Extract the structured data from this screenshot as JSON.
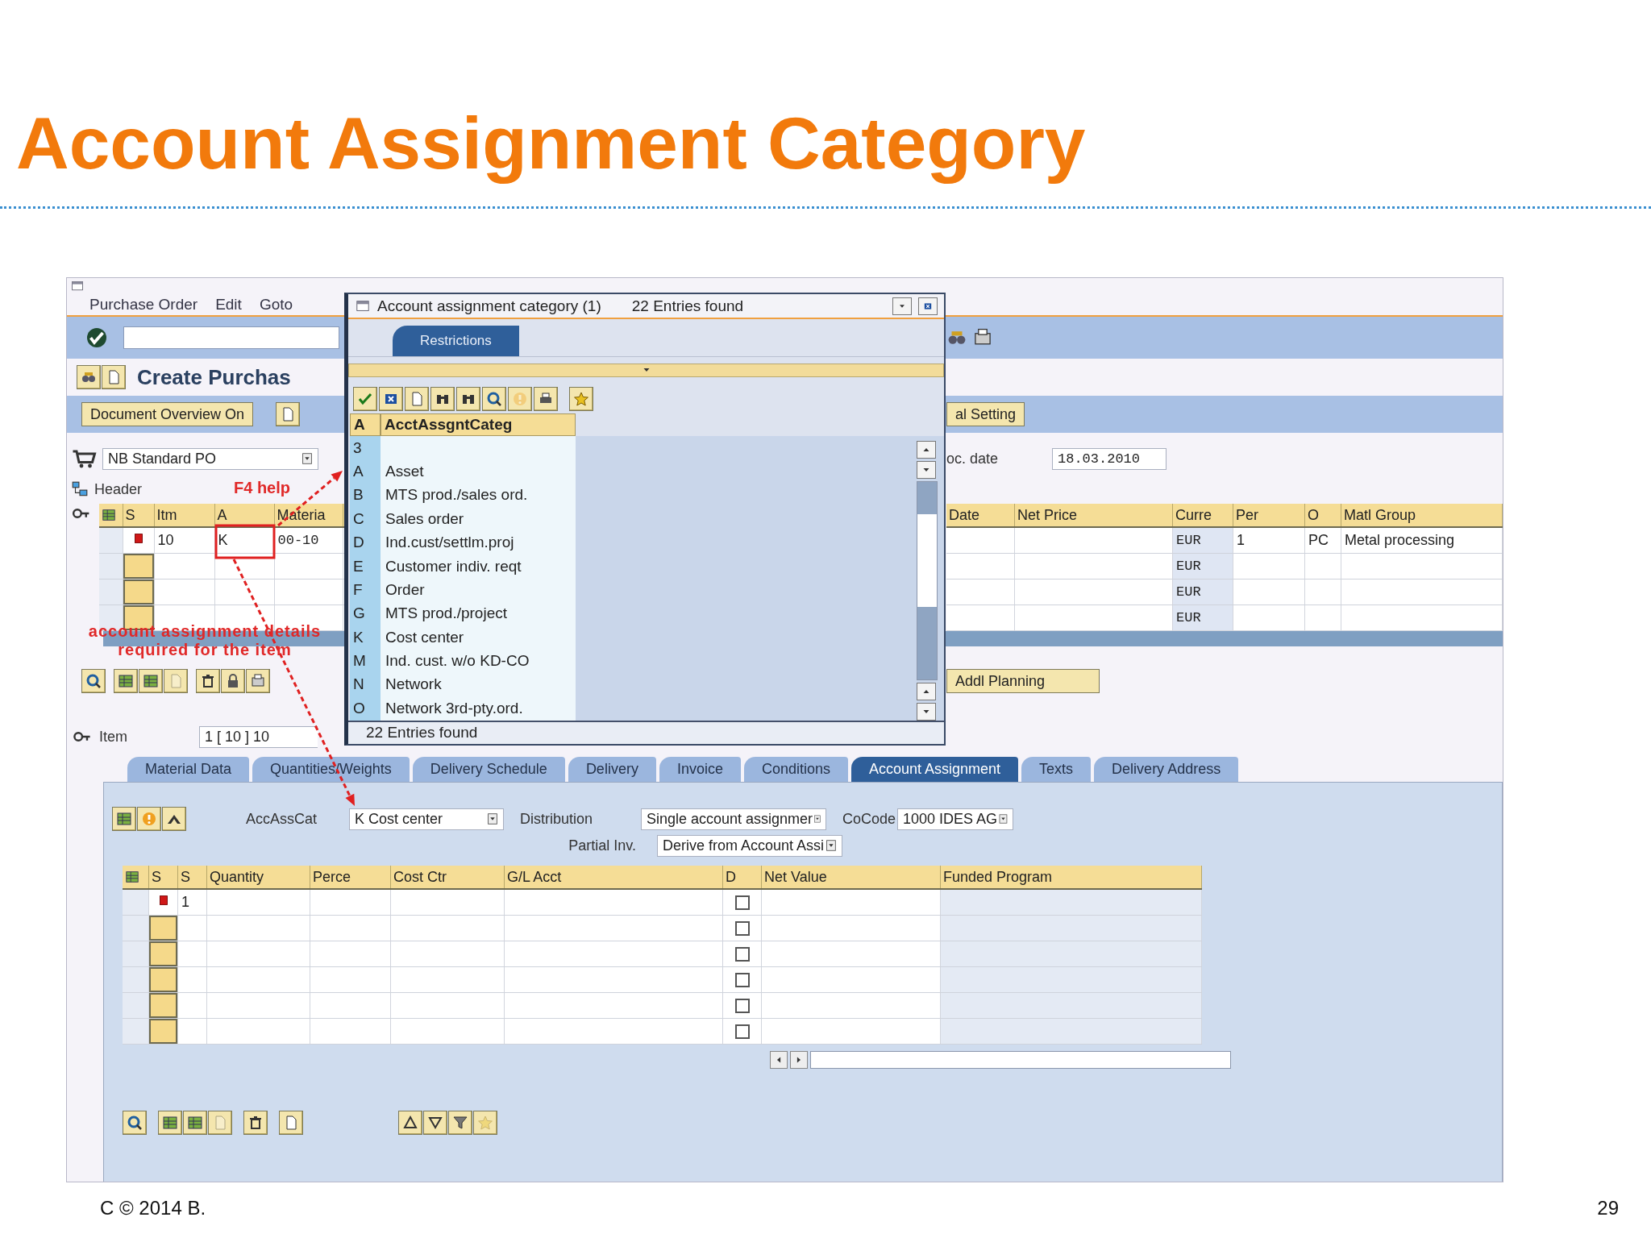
{
  "slide": {
    "title": "Account Assignment Category",
    "footer": "C © 2014 B.",
    "page_number": "29"
  },
  "window": {
    "menu": [
      "Purchase Order",
      "Edit",
      "Goto"
    ],
    "title": "Create Purchas",
    "overview_button": "Document Overview On",
    "setting_button": "al Setting",
    "po_type": "NB Standard PO",
    "doc_date_label": "oc. date",
    "doc_date": "18.03.2010",
    "header_label": "Header",
    "items_left": {
      "columns": [
        "S",
        "Itm",
        "A",
        "Materia"
      ],
      "rows": [
        {
          "flagged": true,
          "item": "10",
          "acct": "K",
          "material": "00-10"
        },
        {
          "flagged": false
        },
        {
          "flagged": false
        },
        {
          "flagged": false
        }
      ]
    },
    "items_right": {
      "columns": [
        "Date",
        "Net Price",
        "Curre",
        "Per",
        "O",
        "Matl Group"
      ],
      "rows": [
        {
          "currency": "EUR",
          "per": "1",
          "unit": "PC",
          "matl_group": "Metal processing"
        },
        {
          "currency": "EUR"
        },
        {
          "currency": "EUR"
        },
        {
          "currency": "EUR"
        }
      ]
    },
    "planning_button": "Addl Planning",
    "item_label": "Item",
    "item_field": "1 [ 10 ] 10",
    "tabs": [
      {
        "label": "Material Data",
        "selected": false
      },
      {
        "label": "Quantities/Weights",
        "selected": false
      },
      {
        "label": "Delivery Schedule",
        "selected": false
      },
      {
        "label": "Delivery",
        "selected": false
      },
      {
        "label": "Invoice",
        "selected": false
      },
      {
        "label": "Conditions",
        "selected": false
      },
      {
        "label": "Account Assignment",
        "selected": true
      },
      {
        "label": "Texts",
        "selected": false
      },
      {
        "label": "Delivery Address",
        "selected": false
      }
    ],
    "account": {
      "acc_ass_cat_label": "AccAssCat",
      "acc_ass_cat": "K Cost center",
      "distribution_label": "Distribution",
      "distribution": "Single account assignmer",
      "partial_inv_label": "Partial Inv.",
      "partial_inv": "Derive from Account Assi",
      "cocode_label": "CoCode",
      "cocode": "1000 IDES AG"
    },
    "account_table": {
      "columns": [
        "S",
        "S",
        "Quantity",
        "Perce",
        "Cost Ctr",
        "G/L Acct",
        "D",
        "Net Value",
        "Funded Program"
      ],
      "rows": [
        {
          "flagged": true,
          "number": "1",
          "checked": false
        },
        {
          "flagged": false,
          "checked": false
        },
        {
          "flagged": false,
          "checked": false
        },
        {
          "flagged": false,
          "checked": false
        },
        {
          "flagged": false,
          "checked": false
        },
        {
          "flagged": false,
          "checked": false
        }
      ]
    }
  },
  "popup": {
    "title": "Account assignment category (1)",
    "count": "22 Entries found",
    "tabs": [
      {
        "label": "Restrictions",
        "selected": true
      }
    ],
    "columns": [
      "A",
      "AcctAssgntCateg"
    ],
    "rows": [
      {
        "code": "3"
      },
      {
        "code": "A",
        "text": "Asset"
      },
      {
        "code": "B",
        "text": "MTS prod./sales ord."
      },
      {
        "code": "C",
        "text": "Sales order"
      },
      {
        "code": "D",
        "text": "Ind.cust/settlm.proj"
      },
      {
        "code": "E",
        "text": "Customer indiv. reqt"
      },
      {
        "code": "F",
        "text": "Order"
      },
      {
        "code": "G",
        "text": "MTS prod./project"
      },
      {
        "code": "K",
        "text": "Cost center"
      },
      {
        "code": "M",
        "text": "Ind. cust. w/o KD-CO"
      },
      {
        "code": "N",
        "text": "Network"
      },
      {
        "code": "O",
        "text": "Network 3rd-pty.ord."
      }
    ],
    "status": "22 Entries found"
  },
  "annotations": {
    "f4_label": "F4 help",
    "note": "account assignment details required for the item"
  }
}
